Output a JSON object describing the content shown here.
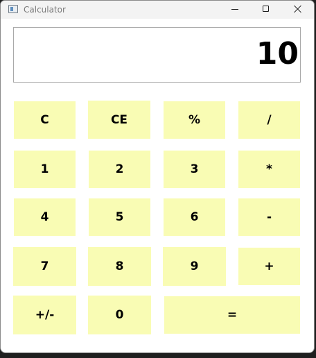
{
  "window": {
    "title": "Calculator"
  },
  "display": {
    "value": "10"
  },
  "keys": {
    "clear": "C",
    "clear_entry": "CE",
    "percent": "%",
    "divide": "/",
    "one": "1",
    "two": "2",
    "three": "3",
    "multiply": "*",
    "four": "4",
    "five": "5",
    "six": "6",
    "subtract": "-",
    "seven": "7",
    "eight": "8",
    "nine": "9",
    "add": "+",
    "negate": "+/-",
    "zero": "0",
    "equals": "="
  },
  "colors": {
    "key_background": "#f9fcb4",
    "window_background": "#ffffff"
  }
}
